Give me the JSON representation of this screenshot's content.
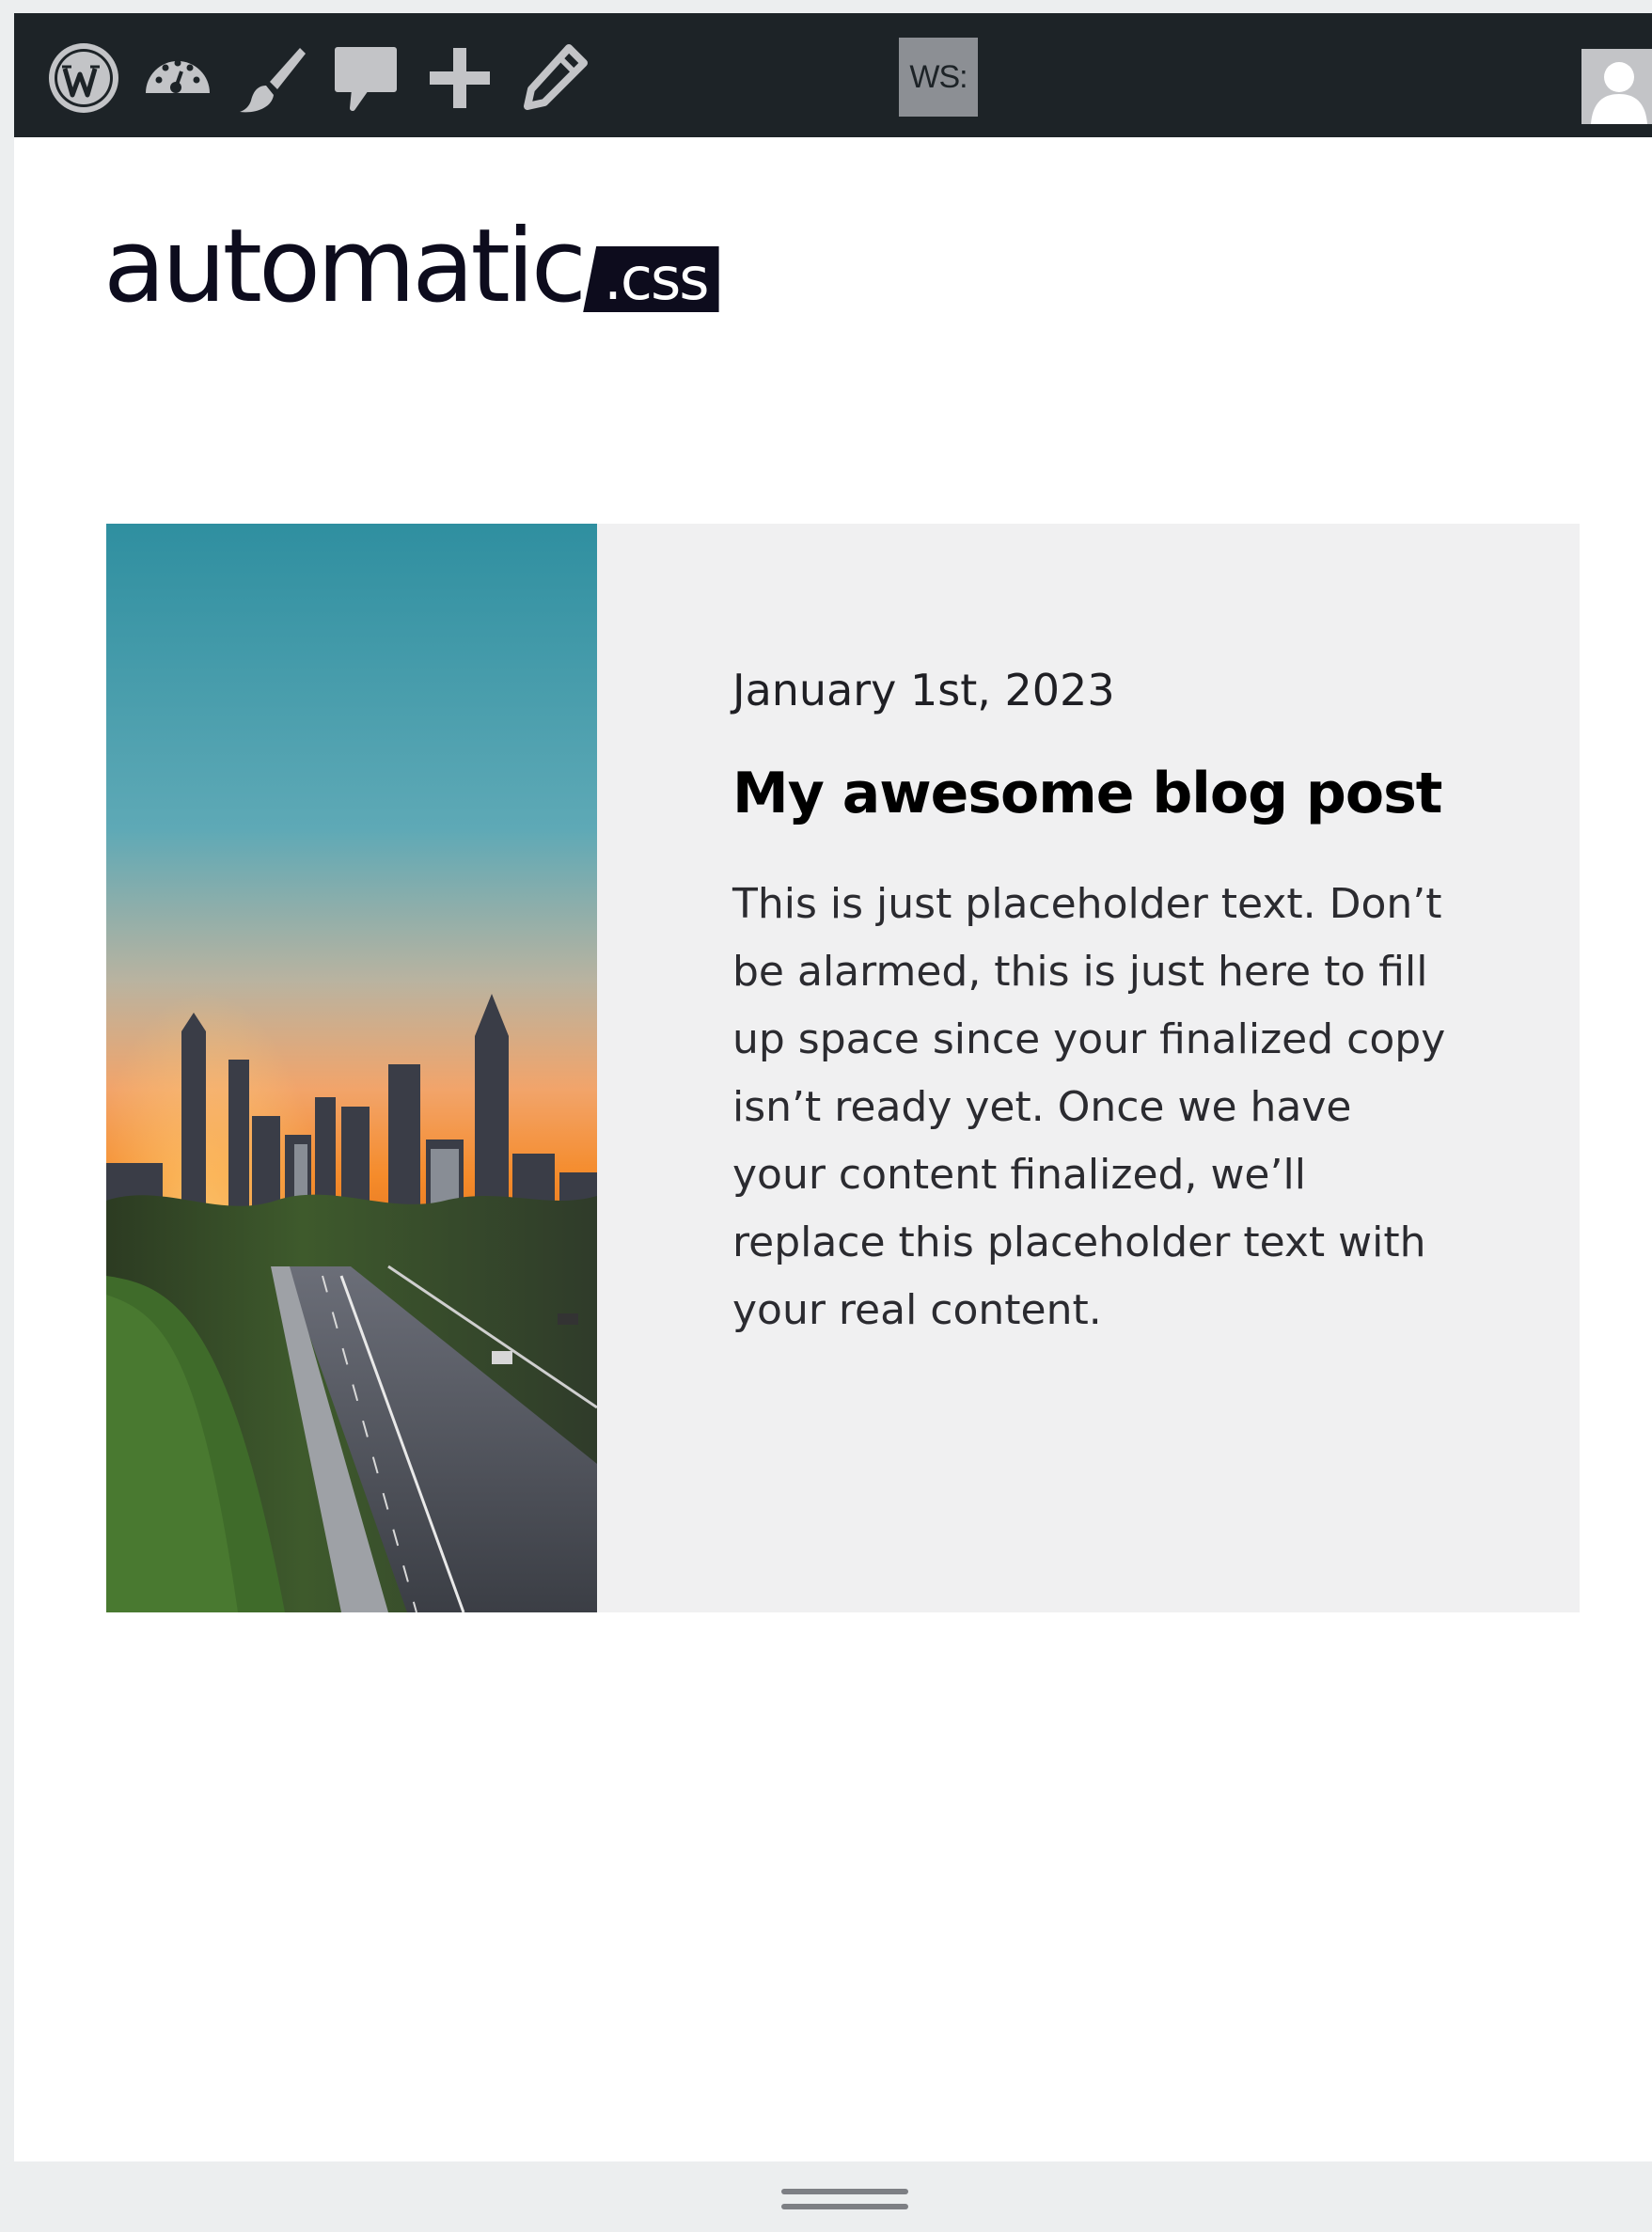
{
  "admin_bar": {
    "icons": [
      "wordpress-logo",
      "dashboard-gauge",
      "customize-brush",
      "comments-bubble",
      "add-new-plus",
      "edit-pencil"
    ],
    "ws_label": "WS:",
    "background": "#1d2327"
  },
  "logo": {
    "word": "automatic",
    "badge": ".css"
  },
  "post": {
    "date": "January 1st, 2023",
    "title": "My awesome blog post",
    "excerpt": "This is just placeholder text. Don’t be alarmed, this is just here to fill up space since your finalized copy isn’t ready yet. Once we have your content finalized, we’ll replace this placeholder text with your real content.",
    "image": "city-skyline-sunset-highway"
  },
  "colors": {
    "card_background": "#f0f0f1",
    "text_dark": "#0d0c1d"
  }
}
